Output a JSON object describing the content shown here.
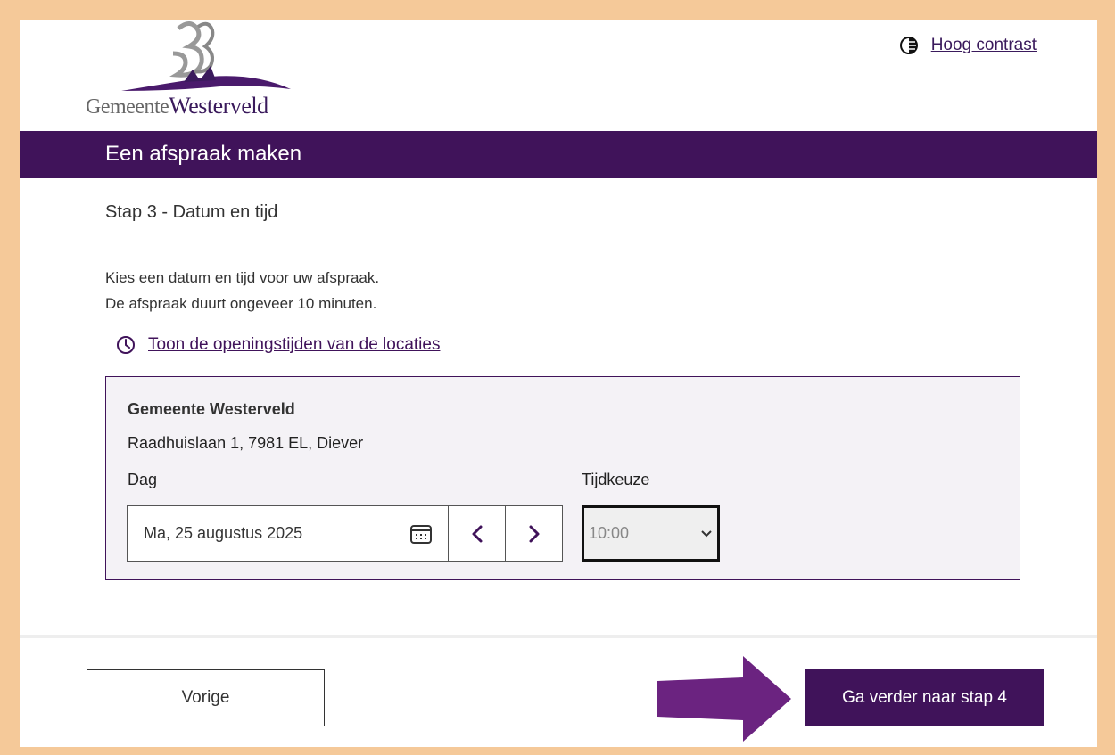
{
  "header": {
    "logo_text_prefix": "Gemeente",
    "logo_text_suffix": "Westerveld",
    "contrast_label": "Hoog contrast"
  },
  "banner": {
    "title": "Een afspraak maken"
  },
  "step": {
    "title": "Stap 3 - Datum en tijd"
  },
  "intro": {
    "line1": "Kies een datum en tijd voor uw afspraak.",
    "line2": "De afspraak duurt ongeveer 10 minuten."
  },
  "hours_link": "Toon de openingstijden van de locaties",
  "location": {
    "name": "Gemeente Westerveld",
    "address": "Raadhuislaan 1, 7981 EL, Diever",
    "day_label": "Dag",
    "day_value": "Ma, 25 augustus 2025",
    "time_label": "Tijdkeuze",
    "time_value": "10:00"
  },
  "footer": {
    "prev_label": "Vorige",
    "next_label": "Ga verder naar stap 4"
  },
  "colors": {
    "brand": "#40135a",
    "frame": "#f5c999",
    "annotation_arrow": "#6b2380"
  },
  "icons": [
    "contrast-icon",
    "clock-icon",
    "calendar-icon",
    "chevron-left-icon",
    "chevron-right-icon",
    "chevron-down-icon",
    "arrow-right-icon"
  ]
}
